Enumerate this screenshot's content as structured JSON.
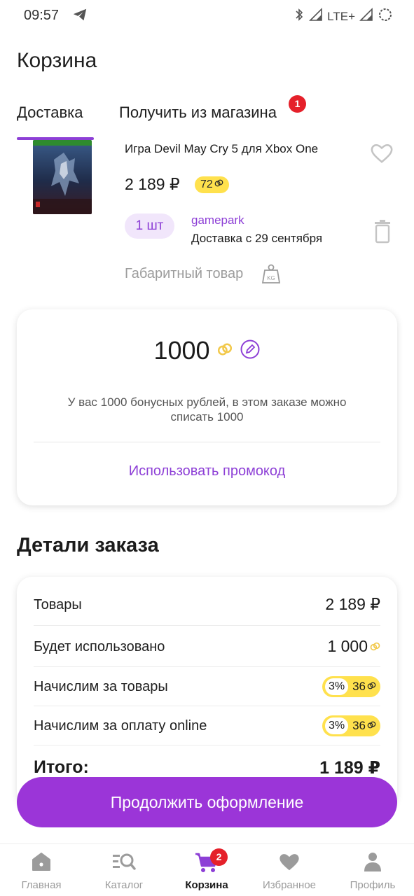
{
  "status_bar": {
    "time": "09:57",
    "network": "LTE+"
  },
  "header": {
    "title": "Корзина"
  },
  "tabs": [
    {
      "label": "Доставка",
      "active": true
    },
    {
      "label": "Получить из магазина",
      "badge": "1"
    }
  ],
  "product": {
    "name": "Игра Devil May Cry 5 для Xbox One",
    "price": "2 189 ₽",
    "bonus": "72",
    "quantity": "1 шт",
    "seller": "gamepark",
    "delivery": "Доставка с 29 сентября",
    "oversize_label": "Габаритный товар"
  },
  "bonus_card": {
    "amount": "1000",
    "info": "У вас 1000 бонусных рублей, в этом заказе можно списать 1000",
    "promo_link": "Использовать промокод"
  },
  "order_details": {
    "title": "Детали заказа",
    "goods_label": "Товары",
    "goods_value": "2 189 ₽",
    "used_label": "Будет использовано",
    "used_value": "1 000",
    "accrual_goods_label": "Начислим за товары",
    "accrual_goods_pct": "3%",
    "accrual_goods_value": "36",
    "accrual_online_label": "Начислим за оплату online",
    "accrual_online_pct": "3%",
    "accrual_online_value": "36",
    "total_label": "Итого:",
    "total_value": "1 189 ₽"
  },
  "continue_button": "Продолжить оформление",
  "nav": {
    "home": "Главная",
    "catalog": "Каталог",
    "cart": "Корзина",
    "cart_badge": "2",
    "favorites": "Избранное",
    "profile": "Профиль"
  },
  "colors": {
    "accent": "#8d3fd6",
    "button": "#9b35d8",
    "bonus": "#ffe14d",
    "badge": "#e5202a"
  }
}
